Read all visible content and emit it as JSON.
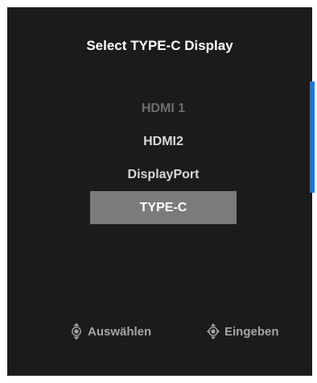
{
  "menu": {
    "title": "Select TYPE-C Display",
    "options": [
      {
        "label": "HDMI 1",
        "state": "disabled"
      },
      {
        "label": "HDMI2",
        "state": "normal"
      },
      {
        "label": "DisplayPort",
        "state": "normal"
      },
      {
        "label": "TYPE-C",
        "state": "selected"
      }
    ]
  },
  "hints": {
    "select_label": "Auswählen",
    "select_icon": "joystick-up-down-icon",
    "enter_label": "Eingeben",
    "enter_icon": "joystick-press-icon"
  },
  "colors": {
    "background": "#1b1b1b",
    "highlight": "#7b7b7b",
    "accent": "#1877d6"
  }
}
